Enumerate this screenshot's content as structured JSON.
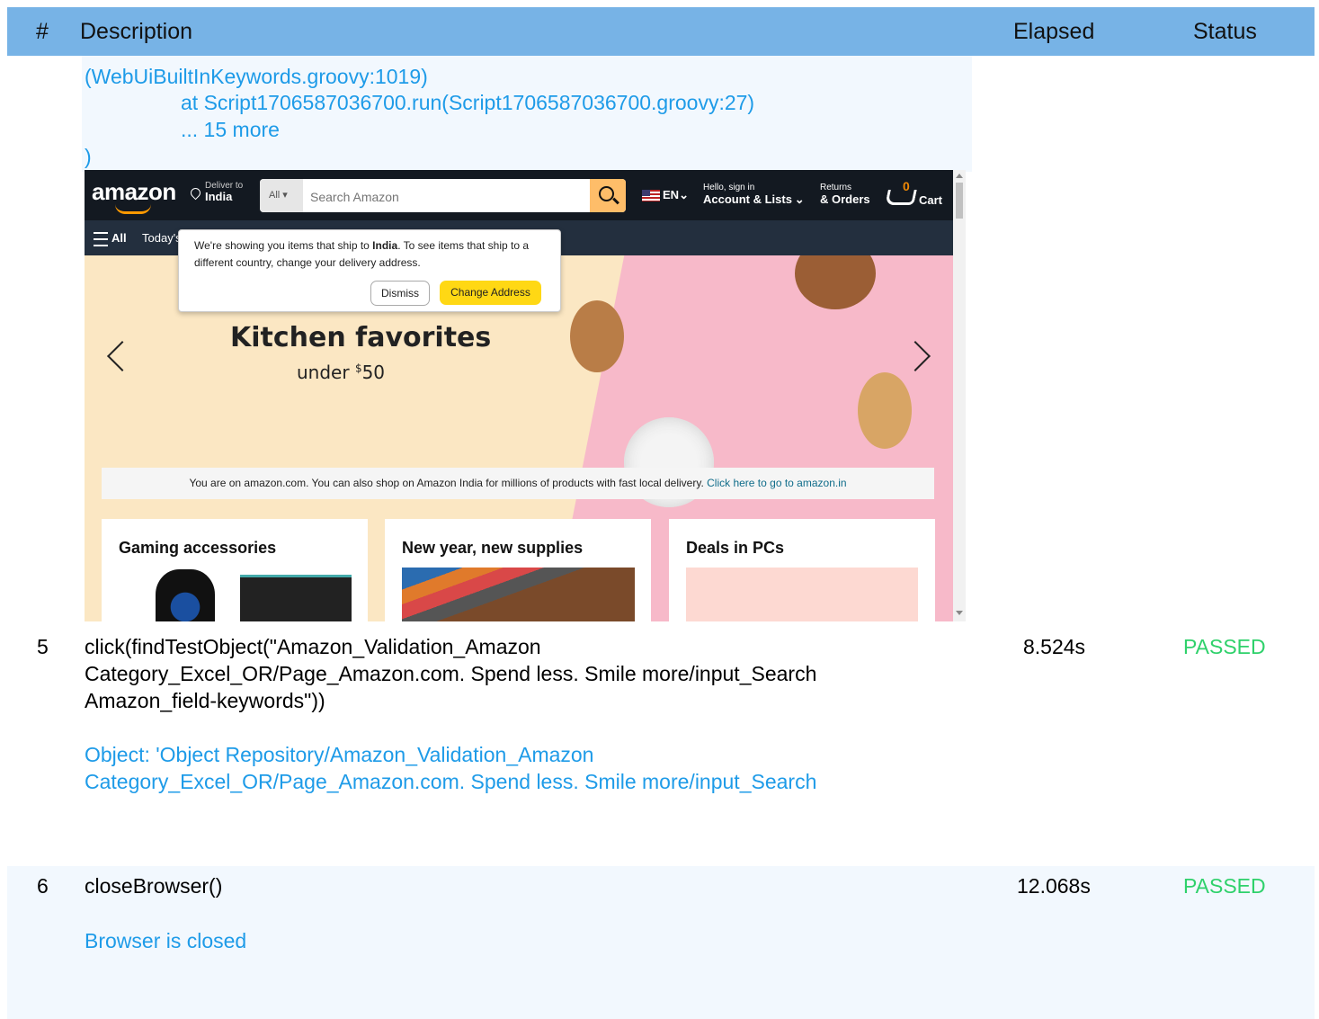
{
  "header": {
    "num": "#",
    "description": "Description",
    "elapsed": "Elapsed",
    "status": "Status"
  },
  "log_lines": [
    "(WebUiBuiltInKeywords.groovy:1019)",
    "at Script1706587036700.run(Script1706587036700.groovy:27)",
    "... 15 more",
    ")"
  ],
  "screenshot": {
    "logo": "amazon",
    "deliver_to": "Deliver to",
    "deliver_country": "India",
    "search_category": "All",
    "search_placeholder": "Search Amazon",
    "language": "EN",
    "hello": "Hello, sign in",
    "account": "Account & Lists",
    "returns": "Returns",
    "orders": "& Orders",
    "cart_count": "0",
    "cart": "Cart",
    "all_menu": "All",
    "today": "Today's",
    "popup_text_1": "We're showing you items that ship to ",
    "popup_country": "India",
    "popup_text_2": ". To see items that ship to a different country, change your delivery address.",
    "dismiss": "Dismiss",
    "change_address": "Change Address",
    "hero_title": "Kitchen favorites",
    "hero_under": "under ",
    "hero_currency": "$",
    "hero_price": "50",
    "notice_text": "You are on amazon.com. You can also shop on Amazon India for millions of products with fast local delivery. ",
    "notice_link": "Click here to go to amazon.in",
    "cards": [
      "Gaming accessories",
      "New year, new supplies",
      "Deals in PCs"
    ]
  },
  "steps": [
    {
      "num": "5",
      "description": "click(findTestObject(\"Amazon_Validation_Amazon Category_Excel_OR/Page_Amazon.com. Spend less. Smile more/input_Search Amazon_field-keywords\"))",
      "detail": "Object: 'Object Repository/Amazon_Validation_Amazon Category_Excel_OR/Page_Amazon.com. Spend less. Smile more/input_Search",
      "elapsed": "8.524s",
      "status": "PASSED"
    },
    {
      "num": "6",
      "description": "closeBrowser()",
      "detail": "Browser is closed",
      "elapsed": "12.068s",
      "status": "PASSED"
    }
  ],
  "colors": {
    "header_bg": "#77b3e6",
    "link": "#1e9be8",
    "passed": "#2fd16b",
    "row_bg": "#f2f8fe"
  }
}
